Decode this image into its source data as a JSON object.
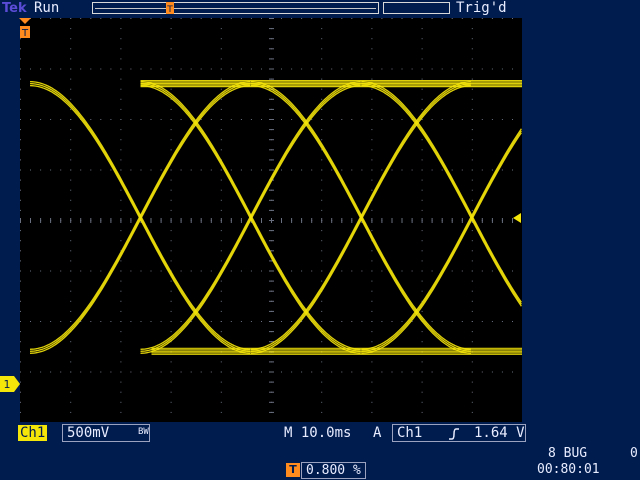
{
  "header": {
    "brand": "Tek",
    "acq_status": "Run",
    "trigger_status": "Trig'd"
  },
  "markers": {
    "trigger_position_glyph": "T",
    "channel_ground_label": "1"
  },
  "bottom": {
    "channel_label": "Ch1",
    "channel_scale": "500mV",
    "bandwidth_icon": "BW",
    "timebase": "M 10.0ms",
    "trigger_mode": "A",
    "trigger_source": "Ch1",
    "trigger_slope_icon": "rising-edge-icon",
    "trigger_level": "1.64 V",
    "counter_left": "8 BUG",
    "counter_right": "0",
    "clock": "00:80:01",
    "trigger_position_label": "T",
    "trigger_position_value": "0.800 %"
  },
  "colors": {
    "background": "#001c4e",
    "trace": "#f5e60a",
    "graticule": "#000000",
    "grid_dots": "#6b7080",
    "marker_orange": "#ff8a1e"
  },
  "chart_data": {
    "type": "line",
    "title": "",
    "xlabel": "",
    "ylabel": "",
    "grid": true,
    "divisions_x": 10,
    "divisions_y": 8,
    "ylim_div": [
      -4,
      4
    ],
    "xlim_div": [
      0,
      10
    ],
    "series": [
      {
        "values_div": "eye-diagram",
        "high_level_div": 2.7,
        "low_level_div": -2.6,
        "crossings_div": [
          4.6,
          6.8,
          9.0
        ]
      }
    ]
  }
}
